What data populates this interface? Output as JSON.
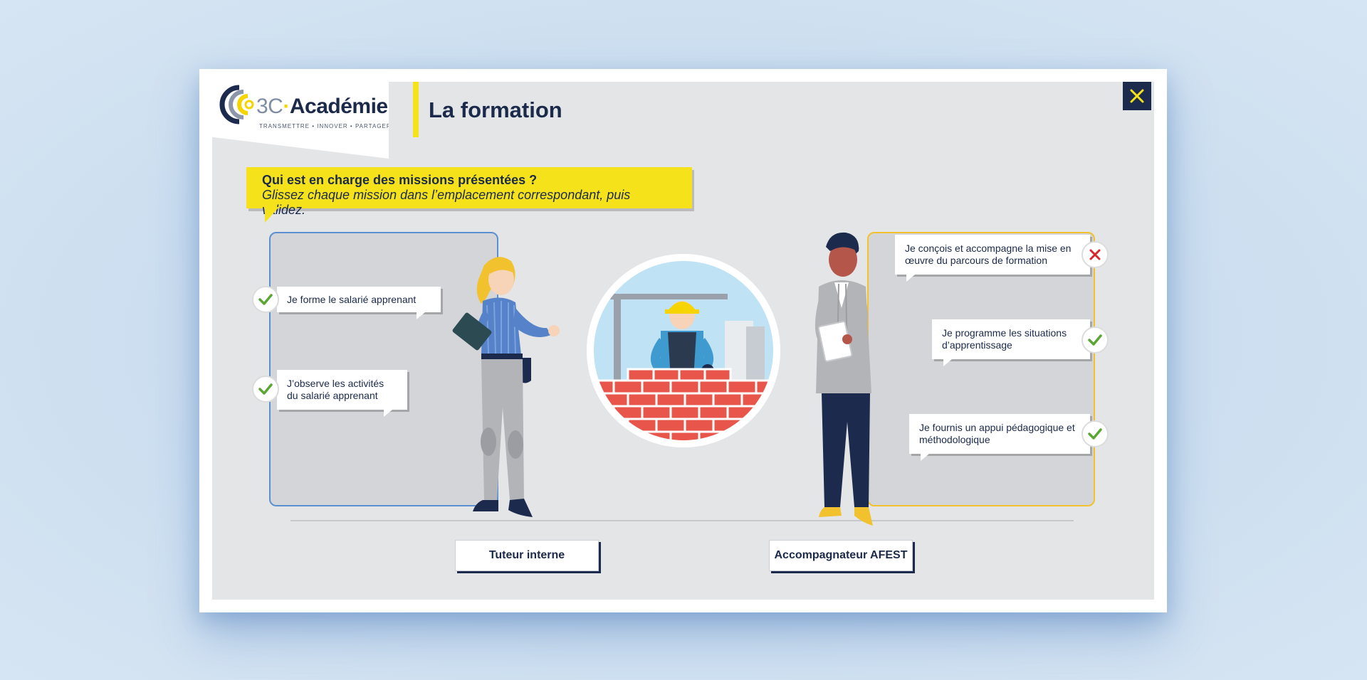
{
  "brand": {
    "prefix": "3C",
    "separator": "·",
    "name": "Académie",
    "tagline": "TRANSMETTRE • INNOVER • PARTAGER"
  },
  "header": {
    "title": "La formation"
  },
  "close": {
    "icon": "close-icon"
  },
  "instruction": {
    "question": "Qui est en charge des missions présentées ?",
    "hint": "Glissez chaque mission dans l’emplacement correspondant, puis validez."
  },
  "left_zone": {
    "role": "Tuteur interne",
    "missions": [
      {
        "text": "Je forme le salarié apprenant",
        "status": "correct"
      },
      {
        "text": "J’observe les activités du salarié apprenant",
        "status": "correct"
      }
    ]
  },
  "right_zone": {
    "role": "Accompagnateur AFEST",
    "missions": [
      {
        "text": "Je conçois et accompagne la mise en œuvre du parcours de formation",
        "status": "incorrect"
      },
      {
        "text": "Je programme les situations d’apprentissage",
        "status": "correct"
      },
      {
        "text": "Je fournis un appui pédagogique et méthodologique",
        "status": "correct"
      }
    ]
  },
  "colors": {
    "accent_yellow": "#f6e21a",
    "navy": "#1c2a4d",
    "zone_left_border": "#5b8fd0",
    "zone_right_border": "#f2c12e",
    "check_green": "#5aa632",
    "cross_red": "#d9252a"
  }
}
